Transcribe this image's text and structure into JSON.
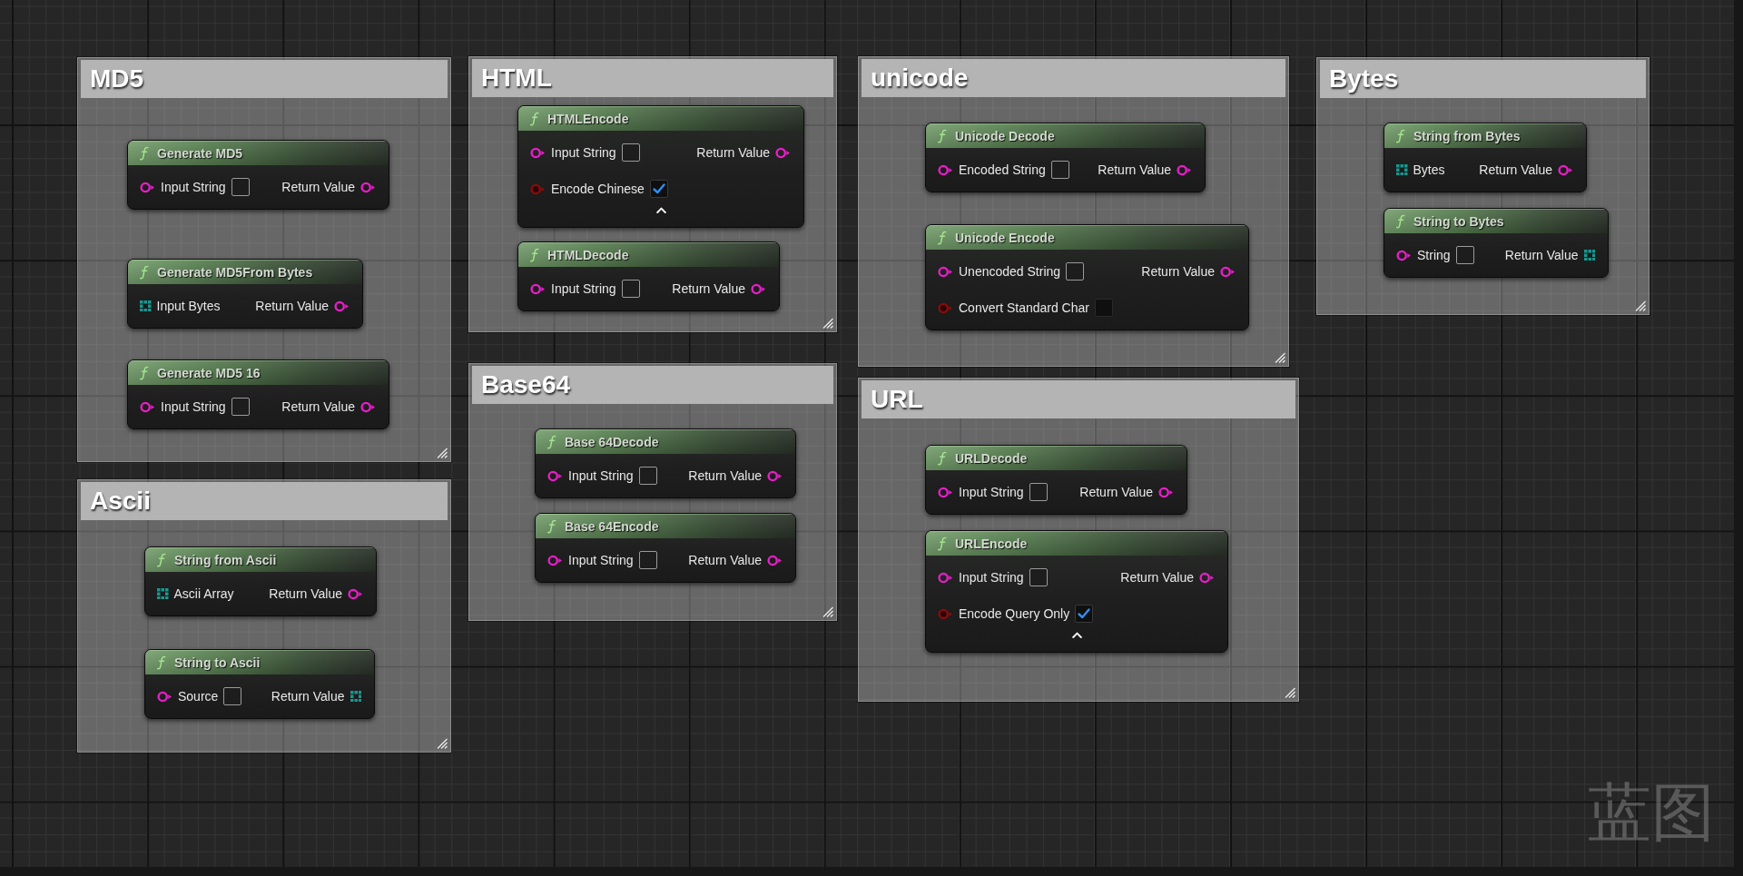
{
  "comments": [
    {
      "title": "MD5",
      "nodes": [
        {
          "title": "Generate MD5",
          "inputs": [
            {
              "kind": "string",
              "label": "Input String"
            }
          ],
          "outputs": [
            {
              "kind": "string",
              "label": "Return Value"
            }
          ]
        },
        {
          "title": "Generate MD5From Bytes",
          "inputs": [
            {
              "kind": "array",
              "label": "Input Bytes"
            }
          ],
          "outputs": [
            {
              "kind": "string",
              "label": "Return Value"
            }
          ]
        },
        {
          "title": "Generate MD5 16",
          "inputs": [
            {
              "kind": "string",
              "label": "Input String"
            }
          ],
          "outputs": [
            {
              "kind": "string",
              "label": "Return Value"
            }
          ]
        }
      ]
    },
    {
      "title": "Ascii",
      "nodes": [
        {
          "title": "String from Ascii",
          "inputs": [
            {
              "kind": "array",
              "label": "Ascii Array"
            }
          ],
          "outputs": [
            {
              "kind": "string",
              "label": "Return Value"
            }
          ]
        },
        {
          "title": "String to Ascii",
          "inputs": [
            {
              "kind": "string",
              "label": "Source"
            }
          ],
          "outputs": [
            {
              "kind": "array",
              "label": "Return Value"
            }
          ]
        }
      ]
    },
    {
      "title": "HTML",
      "nodes": [
        {
          "title": "HTMLEncode",
          "inputs": [
            {
              "kind": "string",
              "label": "Input String"
            },
            {
              "kind": "bool",
              "label": "Encode Chinese",
              "checked": true
            }
          ],
          "outputs": [
            {
              "kind": "string",
              "label": "Return Value"
            }
          ],
          "expanded": true
        },
        {
          "title": "HTMLDecode",
          "inputs": [
            {
              "kind": "string",
              "label": "Input String"
            }
          ],
          "outputs": [
            {
              "kind": "string",
              "label": "Return Value"
            }
          ]
        }
      ]
    },
    {
      "title": "Base64",
      "nodes": [
        {
          "title": "Base 64Decode",
          "inputs": [
            {
              "kind": "string",
              "label": "Input String"
            }
          ],
          "outputs": [
            {
              "kind": "string",
              "label": "Return Value"
            }
          ]
        },
        {
          "title": "Base 64Encode",
          "inputs": [
            {
              "kind": "string",
              "label": "Input String"
            }
          ],
          "outputs": [
            {
              "kind": "string",
              "label": "Return Value"
            }
          ]
        }
      ]
    },
    {
      "title": "unicode",
      "nodes": [
        {
          "title": "Unicode Decode",
          "inputs": [
            {
              "kind": "string",
              "label": "Encoded String"
            }
          ],
          "outputs": [
            {
              "kind": "string",
              "label": "Return Value"
            }
          ]
        },
        {
          "title": "Unicode Encode",
          "inputs": [
            {
              "kind": "string",
              "label": "Unencoded String"
            },
            {
              "kind": "bool",
              "label": "Convert Standard Char",
              "checked": false
            }
          ],
          "outputs": [
            {
              "kind": "string",
              "label": "Return Value"
            }
          ]
        }
      ]
    },
    {
      "title": "URL",
      "nodes": [
        {
          "title": "URLDecode",
          "inputs": [
            {
              "kind": "string",
              "label": "Input String"
            }
          ],
          "outputs": [
            {
              "kind": "string",
              "label": "Return Value"
            }
          ]
        },
        {
          "title": "URLEncode",
          "inputs": [
            {
              "kind": "string",
              "label": "Input String"
            },
            {
              "kind": "bool",
              "label": "Encode Query Only",
              "checked": true
            }
          ],
          "outputs": [
            {
              "kind": "string",
              "label": "Return Value"
            }
          ],
          "expanded": true
        }
      ]
    },
    {
      "title": "Bytes",
      "nodes": [
        {
          "title": "String from Bytes",
          "inputs": [
            {
              "kind": "array",
              "label": "Bytes"
            }
          ],
          "outputs": [
            {
              "kind": "string",
              "label": "Return Value"
            }
          ]
        },
        {
          "title": "String to Bytes",
          "inputs": [
            {
              "kind": "string",
              "label": "String"
            }
          ],
          "outputs": [
            {
              "kind": "array",
              "label": "Return Value"
            }
          ]
        }
      ]
    }
  ],
  "graph_type_label": "蓝图"
}
